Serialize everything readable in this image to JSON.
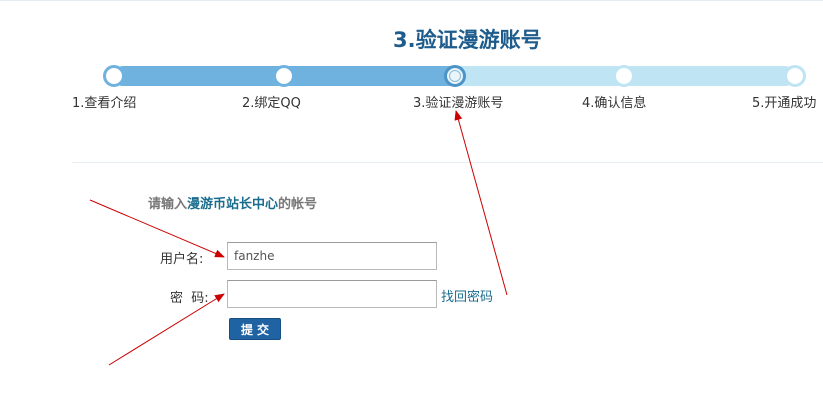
{
  "page_title": "3.验证漫游账号",
  "steps": [
    {
      "label": "1.查看介绍"
    },
    {
      "label": "2.绑定QQ"
    },
    {
      "label": "3.验证漫游账号"
    },
    {
      "label": "4.确认信息"
    },
    {
      "label": "5.开通成功"
    }
  ],
  "current_step": 3,
  "prompt": {
    "prefix": "请输入",
    "highlight": "漫游币站长中心",
    "suffix": "的帐号"
  },
  "form": {
    "username_label": "用户名:",
    "username_value": "fanzhe",
    "password_label": "密  码:",
    "password_value": "",
    "find_password": "找回密码",
    "submit_label": "提交"
  },
  "colors": {
    "title": "#1d5c8c",
    "progress_done": "#6fb2e0",
    "progress_pending": "#bfe4f4",
    "link": "#1a6c8e",
    "button": "#1f63a3",
    "annotation_arrow": "#cc0000"
  }
}
